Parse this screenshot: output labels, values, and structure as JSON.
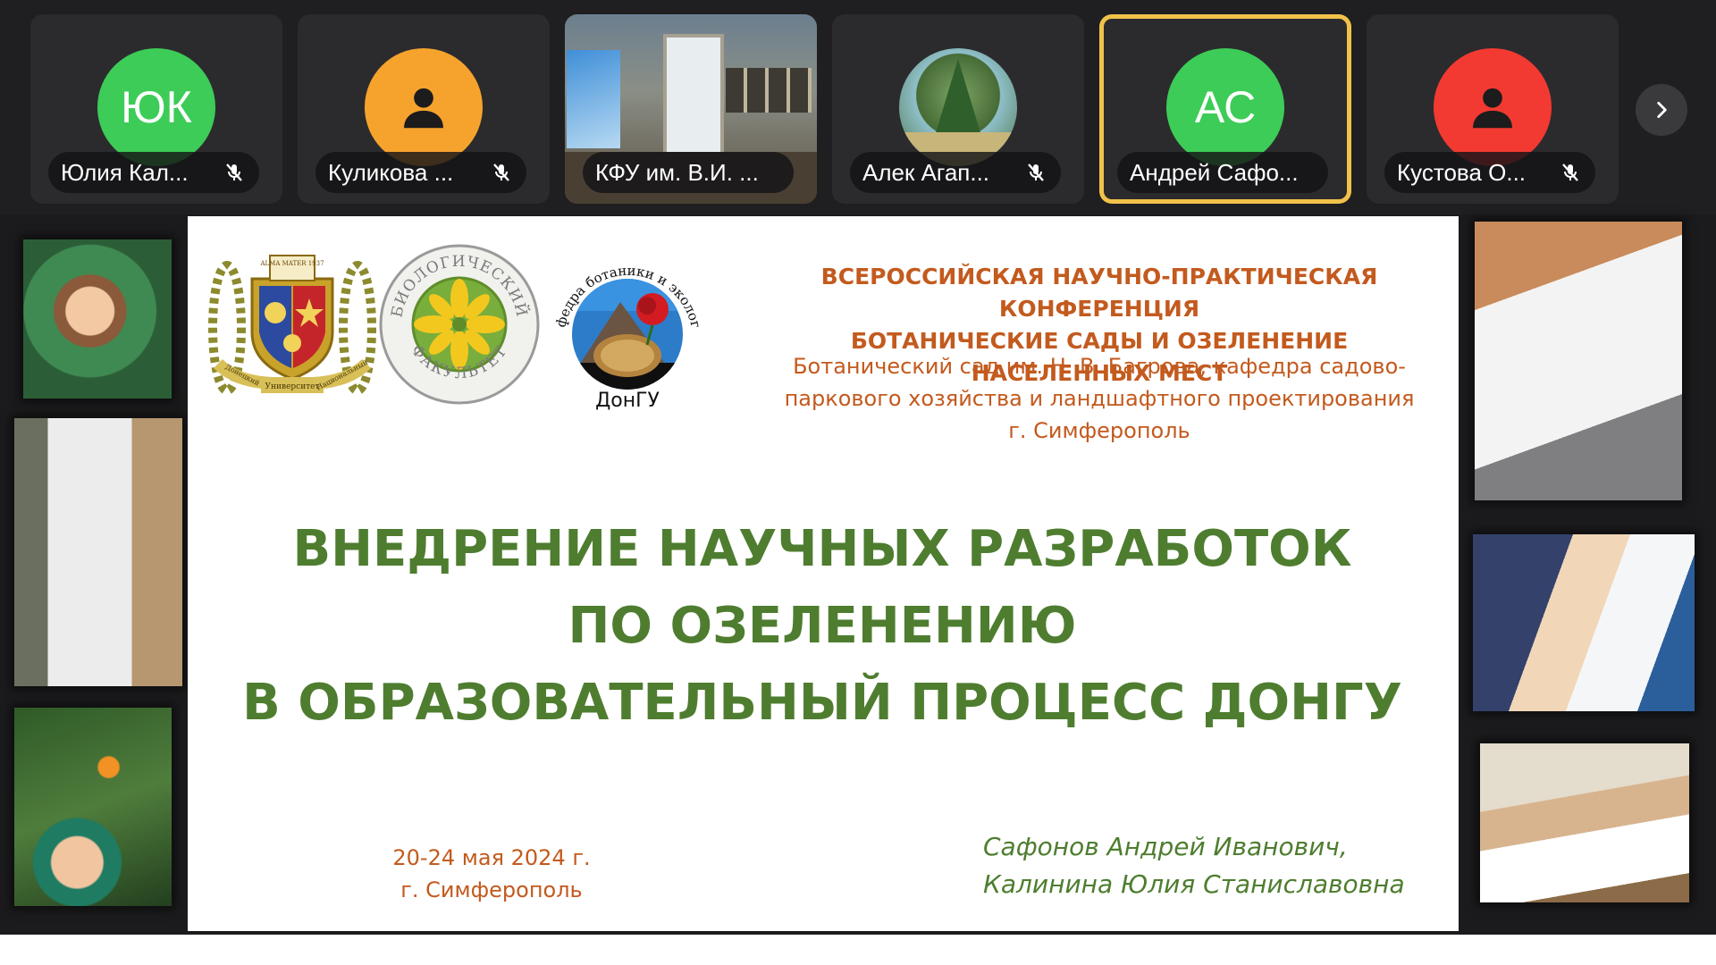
{
  "participants": [
    {
      "name": "Юлия Кал...",
      "initials": "ЮК",
      "avatar_color": "#3dcc57",
      "type": "initials",
      "muted": true,
      "active": false
    },
    {
      "name": "Куликова ...",
      "initials": "",
      "avatar_color": "#f6a32d",
      "type": "person-icon",
      "muted": true,
      "active": false
    },
    {
      "name": "КФУ им. В.И. ...",
      "initials": "",
      "avatar_color": "",
      "type": "video",
      "muted": false,
      "active": false
    },
    {
      "name": "Алек Агап...",
      "initials": "",
      "avatar_color": "",
      "type": "photo",
      "muted": true,
      "active": false
    },
    {
      "name": "Андрей Сафо...",
      "initials": "АС",
      "avatar_color": "#3dcc57",
      "type": "initials",
      "muted": false,
      "active": true
    },
    {
      "name": "Кустова О...",
      "initials": "",
      "avatar_color": "#f23a32",
      "type": "person-icon",
      "muted": true,
      "active": false
    }
  ],
  "next_button_icon": "chevron-right-icon",
  "active_speaker_border_color": "#f1c24a",
  "slide": {
    "conference_title_line1": "ВСЕРОССИЙСКАЯ НАУЧНО-ПРАКТИЧЕСКАЯ КОНФЕРЕНЦИЯ",
    "conference_title_line2": "БОТАНИЧЕСКИЕ САДЫ И ОЗЕЛЕНЕНИЕ НАСЕЛЕННЫХ МЕСТ",
    "venue_line1": "Ботанический сад им. Н. В. Багрова, кафедра садово-",
    "venue_line2": "паркового хозяйства и ландшафтного проектирования",
    "venue_line3": "г. Симферополь",
    "logo_uni_top_text": "ALMA MATER 1937",
    "logo_uni_ribbon_left": "Донецкий",
    "logo_uni_ribbon_right": "Национальный",
    "logo_uni_ribbon_bottom": "Университет",
    "logo_bio_top": "БИОЛОГИЧЕСКИЙ",
    "logo_bio_bottom": "ФАКУЛЬТЕТ",
    "logo_kaf_arc_text": "Кафедра ботаники и экологии",
    "logo_kaf_caption": "ДонГУ",
    "main_title_line1": "ВНЕДРЕНИЕ НАУЧНЫХ РАЗРАБОТОК",
    "main_title_line2": "ПО ОЗЕЛЕНЕНИЮ",
    "main_title_line3": "В ОБРАЗОВАТЕЛЬНЫЙ ПРОЦЕСС ДОНГУ",
    "dates_line1": "20-24 мая 2024 г.",
    "dates_line2": "г. Симферополь",
    "authors_line1": "Сафонов Андрей Иванович,",
    "authors_line2": "Калинина Юлия Станиславовна",
    "accent_orange": "#c35a1e",
    "accent_green": "#4e7d2f"
  }
}
